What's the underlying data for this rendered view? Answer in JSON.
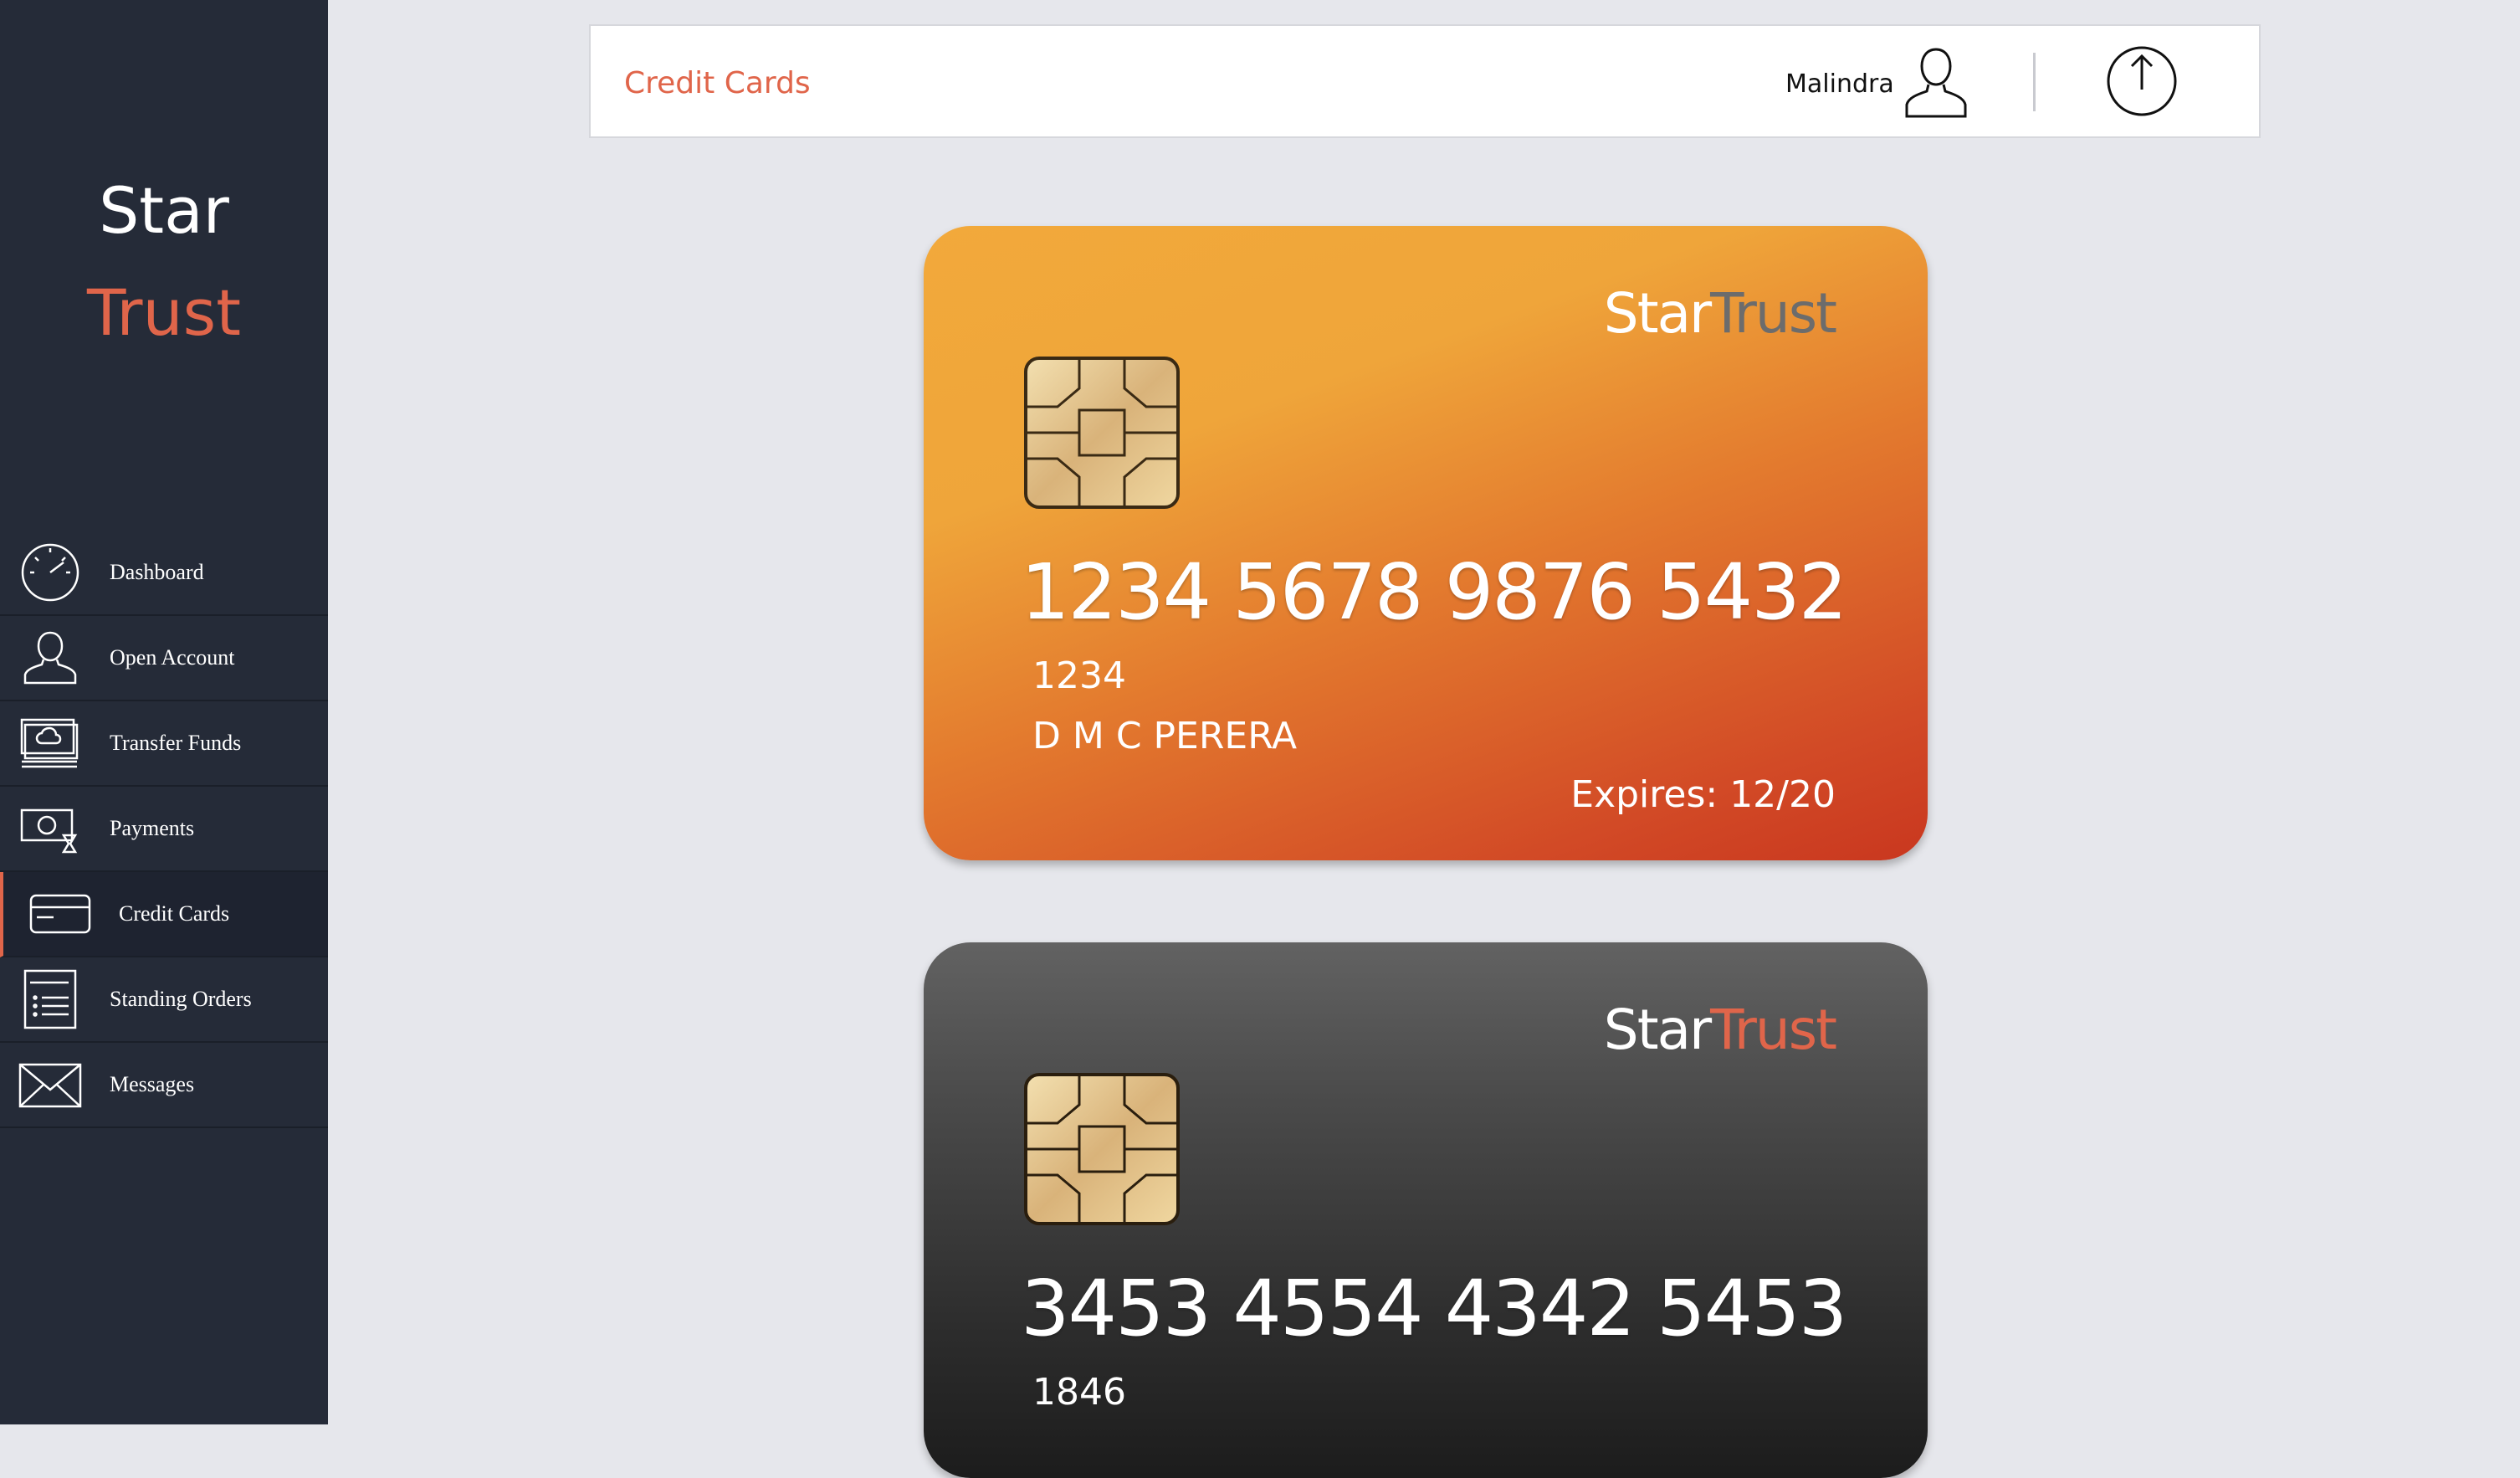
{
  "sidebar": {
    "brand_line1": "Star",
    "brand_line2": "Trust",
    "items": [
      {
        "label": "Dashboard",
        "icon": "speedometer-icon"
      },
      {
        "label": "Open Account",
        "icon": "user-icon"
      },
      {
        "label": "Transfer Funds",
        "icon": "money-transfer-icon"
      },
      {
        "label": "Payments",
        "icon": "payment-icon"
      },
      {
        "label": "Credit Cards",
        "icon": "credit-card-icon",
        "active": true
      },
      {
        "label": "Standing Orders",
        "icon": "list-document-icon"
      },
      {
        "label": "Messages",
        "icon": "envelope-icon"
      }
    ]
  },
  "header": {
    "title": "Credit Cards",
    "username": "Malindra",
    "icons": [
      "user-icon",
      "logout-icon"
    ]
  },
  "cards": [
    {
      "brand_part1": "Star",
      "brand_part2": "Trust",
      "number": "1234 5678 9876 5432",
      "code": "1234",
      "holder": "D M C PERERA",
      "expiry": "Expires: 12/20",
      "style": "orange"
    },
    {
      "brand_part1": "Star",
      "brand_part2": "Trust",
      "number": "3453 4554 4342 5453",
      "code": "1846",
      "style": "dark"
    }
  ],
  "colors": {
    "accent": "#e0654a",
    "sidebar_bg": "#252b38",
    "page_bg": "#e6e7ec"
  }
}
